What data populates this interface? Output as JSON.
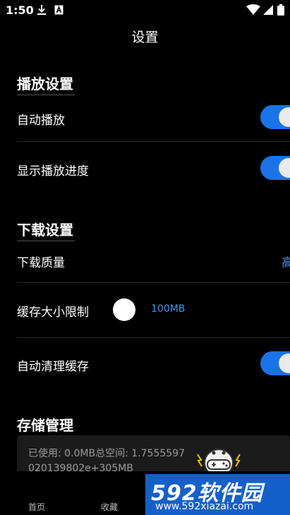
{
  "status_bar": {
    "time": "1:50",
    "icons": [
      "download-icon",
      "a-icon",
      "wifi-icon",
      "signal-icon",
      "battery-icon"
    ]
  },
  "page": {
    "title": "设置"
  },
  "sections": {
    "playback": {
      "header": "播放设置",
      "autoplay_label": "自动播放",
      "autoplay_on": true,
      "progress_label": "显示播放进度",
      "progress_on": true
    },
    "download": {
      "header": "下载设置",
      "quality_label": "下载质量",
      "quality_value": "高",
      "cache_label": "缓存大小限制",
      "cache_value": "100MB",
      "auto_clear_label": "自动清理缓存",
      "auto_clear_on": true
    },
    "storage": {
      "header": "存储管理",
      "info": "已使用: 0.0MB总空间: 1.7555597020139802e+305MB"
    }
  },
  "bottom_nav": {
    "items": [
      {
        "label": "首页"
      },
      {
        "label": "收藏"
      }
    ]
  },
  "watermark": {
    "brand": "592软件园",
    "url": "www.592xiazai.com"
  },
  "colors": {
    "background": "#000000",
    "accent": "#1a73e8",
    "value_text": "#4a90e2"
  }
}
